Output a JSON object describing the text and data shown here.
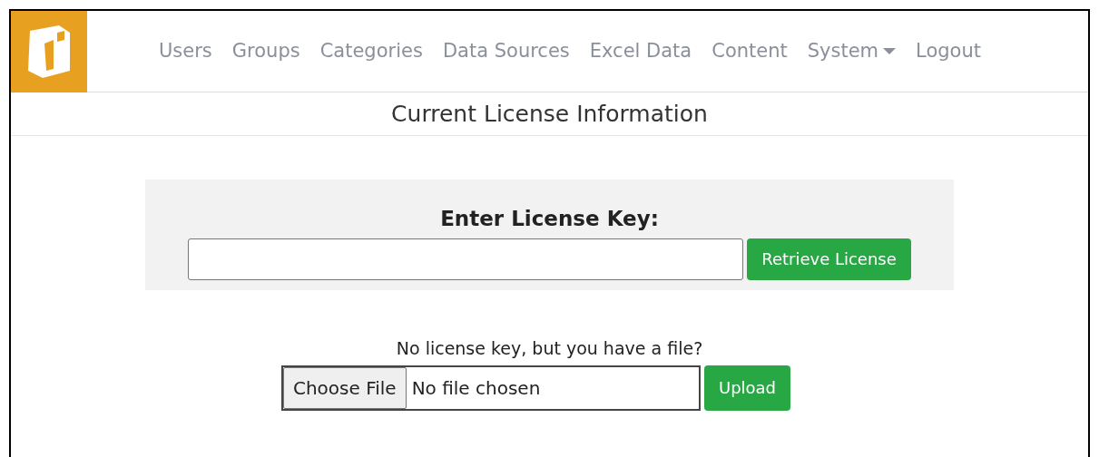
{
  "nav": [
    {
      "label": "Users",
      "kind": "link"
    },
    {
      "label": "Groups",
      "kind": "link"
    },
    {
      "label": "Categories",
      "kind": "link"
    },
    {
      "label": "Data Sources",
      "kind": "link"
    },
    {
      "label": "Excel Data",
      "kind": "link"
    },
    {
      "label": "Content",
      "kind": "link"
    },
    {
      "label": "System",
      "kind": "dropdown"
    },
    {
      "label": "Logout",
      "kind": "link"
    }
  ],
  "page_title": "Current License Information",
  "license_form": {
    "heading": "Enter License Key:",
    "button": "Retrieve License"
  },
  "file_form": {
    "prompt": "No license key, but you have a file?",
    "choose_button": "Choose File",
    "file_status": "No file chosen",
    "button": "Upload"
  }
}
